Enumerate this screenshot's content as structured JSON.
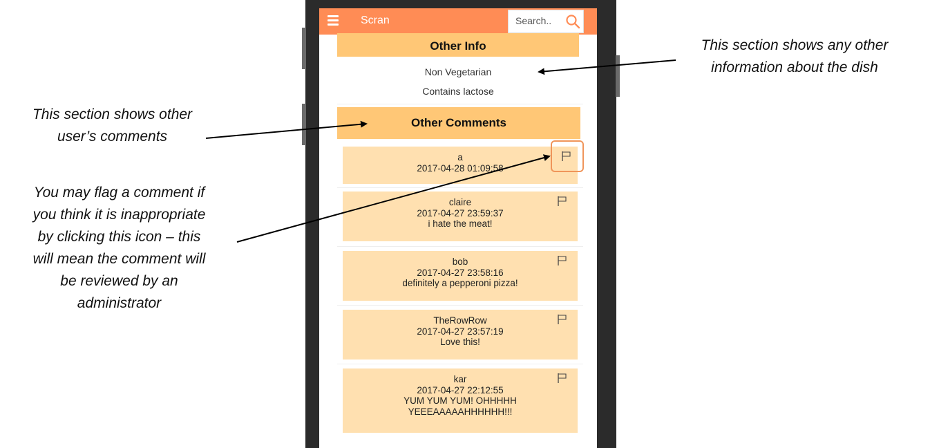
{
  "app": {
    "title": "Scran",
    "search_placeholder": "Search.."
  },
  "other_info": {
    "header": "Other Info",
    "items": [
      "Non Vegetarian",
      "Contains lactose"
    ]
  },
  "other_comments": {
    "header": "Other Comments",
    "comments": [
      {
        "user": "a",
        "timestamp": "2017-04-28 01:09:58",
        "text": ""
      },
      {
        "user": "claire",
        "timestamp": "2017-04-27 23:59:37",
        "text": "i hate the meat!"
      },
      {
        "user": "bob",
        "timestamp": "2017-04-27 23:58:16",
        "text": "definitely a pepperoni pizza!"
      },
      {
        "user": "TheRowRow",
        "timestamp": "2017-04-27 23:57:19",
        "text": "Love this!"
      },
      {
        "user": "kar",
        "timestamp": "2017-04-27 22:12:55",
        "text": "YUM YUM YUM! OHHHHH",
        "text2": "YEEEAAAAAHHHHHH!!!"
      }
    ]
  },
  "annotations": {
    "other_info_note": [
      "This section shows any other",
      "information about the dish"
    ],
    "comments_note": [
      "This section shows other",
      "user’s comments"
    ],
    "flag_note": [
      "You may flag a comment if",
      "you think it is inappropriate",
      "by clicking this icon – this",
      "will mean the comment will",
      "be reviewed by an",
      "administrator"
    ]
  },
  "colors": {
    "app_bar": "#ff8c55",
    "section_header": "#ffc776",
    "comment_card": "#ffe0b0",
    "highlight": "#f0955a"
  }
}
